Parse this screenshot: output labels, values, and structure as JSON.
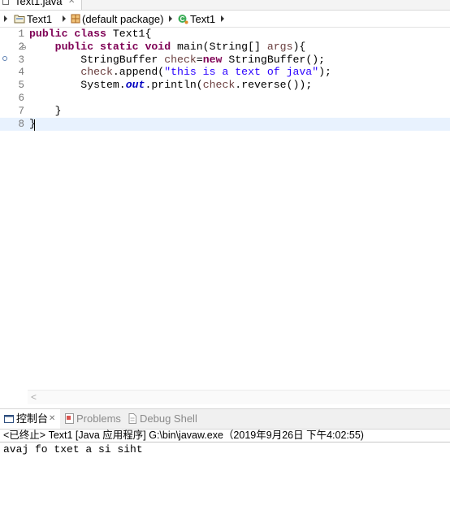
{
  "editor_tab": {
    "title": "Text1.java",
    "close": "✕"
  },
  "breadcrumb": {
    "items": [
      {
        "label": "Text1",
        "icon": "project-folder-icon"
      },
      {
        "label": "(default package)",
        "icon": "package-icon"
      },
      {
        "label": "Text1",
        "icon": "class-icon"
      }
    ]
  },
  "code": {
    "line_numbers": [
      "1",
      "2",
      "3",
      "4",
      "5",
      "6",
      "7",
      "8"
    ],
    "lines": [
      [
        {
          "t": "public class ",
          "c": "kw"
        },
        {
          "t": "Text1{",
          "c": "plain"
        }
      ],
      [
        {
          "t": "    ",
          "c": "plain"
        },
        {
          "t": "public static void ",
          "c": "kw"
        },
        {
          "t": "main(String[] ",
          "c": "plain"
        },
        {
          "t": "args",
          "c": "var"
        },
        {
          "t": "){",
          "c": "plain"
        }
      ],
      [
        {
          "t": "        StringBuffer ",
          "c": "plain"
        },
        {
          "t": "check",
          "c": "var"
        },
        {
          "t": "=",
          "c": "plain"
        },
        {
          "t": "new ",
          "c": "kw"
        },
        {
          "t": "StringBuffer();",
          "c": "plain"
        }
      ],
      [
        {
          "t": "        ",
          "c": "plain"
        },
        {
          "t": "check",
          "c": "var"
        },
        {
          "t": ".append(",
          "c": "plain"
        },
        {
          "t": "\"this is a text of java\"",
          "c": "str"
        },
        {
          "t": ");",
          "c": "plain"
        }
      ],
      [
        {
          "t": "        System.",
          "c": "plain"
        },
        {
          "t": "out",
          "c": "fld"
        },
        {
          "t": ".println(",
          "c": "plain"
        },
        {
          "t": "check",
          "c": "var"
        },
        {
          "t": ".reverse());",
          "c": "plain"
        }
      ],
      [],
      [
        {
          "t": "    }",
          "c": "plain"
        }
      ],
      [
        {
          "t": "}",
          "c": "plain"
        }
      ]
    ]
  },
  "scrollbar": {
    "left_arrow": "<"
  },
  "console": {
    "tabs": [
      {
        "label": "控制台",
        "icon": "console-icon",
        "close": "✕"
      },
      {
        "label": "Problems",
        "icon": "problems-icon"
      },
      {
        "label": "Debug Shell",
        "icon": "debug-shell-icon"
      }
    ],
    "header": "<已终止> Text1 [Java 应用程序] G:\\bin\\javaw.exe（2019年9月26日 下午4:02:55)",
    "output": "avaj fo txet a si siht"
  },
  "colors": {
    "keyword": "#7f0055",
    "variable": "#6a3e3e",
    "string": "#2a00ff",
    "field": "#0000c0",
    "current_line": "#e8f2fe"
  }
}
